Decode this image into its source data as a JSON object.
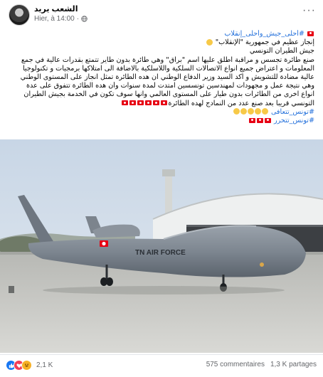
{
  "header": {
    "page_name": "الشعب يريد",
    "timestamp": "Hier, à 14:00",
    "separator": "·",
    "more_label": "···"
  },
  "post": {
    "lines": [
      "#أحلى_جيش_وأحلى_إنقلاب",
      "إنجاز عظيم في جمهورية \"الإنقلاب\"",
      "جيش الطيران التونسي",
      "صنع طائرة تجسس و مراقبة اطلق عليها اسم \"براق\"  وهي طائرة بدون طاير تتمتع بقدرات عالية في جمع",
      "المعلومات و اعتراض جميع انواع الاتصالات السلكية واللاسلكية بالاضافة الى امتلاكها برمجيات و تكنولوجيا",
      "عالية مضادة للتشويش و أكد السيد وزير الدفاع الوطني ان هده الطائرة تمثل انجاز على المستوى الوطني",
      "وهي نتيجة عمل و مجهودات لمهندسين تونسسين امتدت لمدة سنوات وأن هده الطائرة تتفوق على عدة",
      "انواع اخرى من الطائرات بدون طيار على المستوى العالمي وانها سوف تكون في الخدمة بجيش الطيران",
      "التونسي قريبا بعد صنع عدد من النمادج لهده الطائرة",
      "#تونس_تتعافى",
      "#تونس_تتحرر"
    ]
  },
  "photo": {
    "aircraft_marking": "TN AIR FORCE"
  },
  "footer": {
    "reaction_count": "2,1 K",
    "comments": "575 commentaires",
    "shares": "1,3 K partages"
  },
  "colors": {
    "hashtag": "#216fdb",
    "secondary_text": "#65676b",
    "tunisia_red": "#e70013"
  }
}
